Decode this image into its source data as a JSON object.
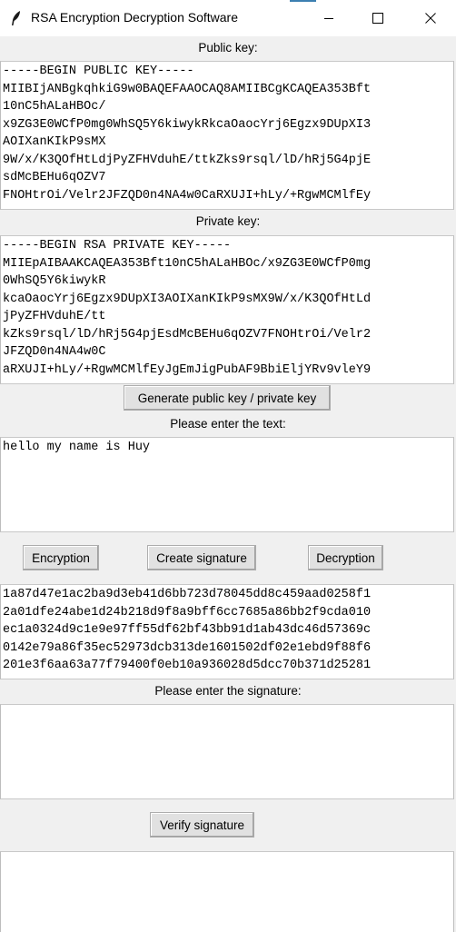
{
  "window": {
    "title": "RSA Encryption Decryption Software",
    "icon": "feather-icon",
    "controls": [
      "minimize-icon",
      "maximize-icon",
      "close-icon"
    ]
  },
  "public_key": {
    "label": "Public key:",
    "lines": [
      "-----BEGIN PUBLIC KEY-----",
      "MIIBIjANBgkqhkiG9w0BAQEFAAOCAQ8AMIIBCgKCAQEA353Bft",
      "10nC5hALaHBOc/",
      "x9ZG3E0WCfP0mg0WhSQ5Y6kiwykRkcaOaocYrj6Egzx9DUpXI3",
      "AOIXanKIkP9sMX",
      "9W/x/K3QOfHtLdjPyZFHVduhE/ttkZks9rsql/lD/hRj5G4pjE",
      "sdMcBEHu6qOZV7",
      "FNOHtrOi/Velr2JFZQD0n4NA4w0CaRXUJI+hLy/+RgwMCMlfEy"
    ]
  },
  "private_key": {
    "label": "Private key:",
    "lines": [
      "-----BEGIN RSA PRIVATE KEY-----",
      "MIIEpAIBAAKCAQEA353Bft10nC5hALaHBOc/x9ZG3E0WCfP0mg",
      "0WhSQ5Y6kiwykR",
      "kcaOaocYrj6Egzx9DUpXI3AOIXanKIkP9sMX9W/x/K3QOfHtLd",
      "jPyZFHVduhE/tt",
      "kZks9rsql/lD/hRj5G4pjEsdMcBEHu6qOZV7FNOHtrOi/Velr2",
      "JFZQD0n4NA4w0C",
      "aRXUJI+hLy/+RgwMCMlfEyJgEmJigPubAF9BbiEljYRv9vleY9"
    ]
  },
  "buttons": {
    "generate": "Generate public key / private key",
    "encryption": "Encryption",
    "create_signature": "Create signature",
    "decryption": "Decryption",
    "verify_signature": "Verify signature"
  },
  "text_input": {
    "label": "Please enter the text:",
    "value": "hello my name is Huy"
  },
  "output": {
    "lines": [
      "1a87d47e1ac2ba9d3eb41d6bb723d78045dd8c459aad0258f1",
      "2a01dfe24abe1d24b218d9f8a9bff6cc7685a86bb2f9cda010",
      "ec1a0324d9c1e9e97ff55df62bf43bb91d1ab43dc46d57369c",
      "0142e79a86f35ec52973dcb313de1601502df02e1ebd9f88f6",
      "201e3f6aa63a77f79400f0eb10a936028d5dcc70b371d25281"
    ]
  },
  "signature_input": {
    "label": "Please enter the signature:",
    "value": ""
  },
  "verify_output": {
    "value": ""
  }
}
